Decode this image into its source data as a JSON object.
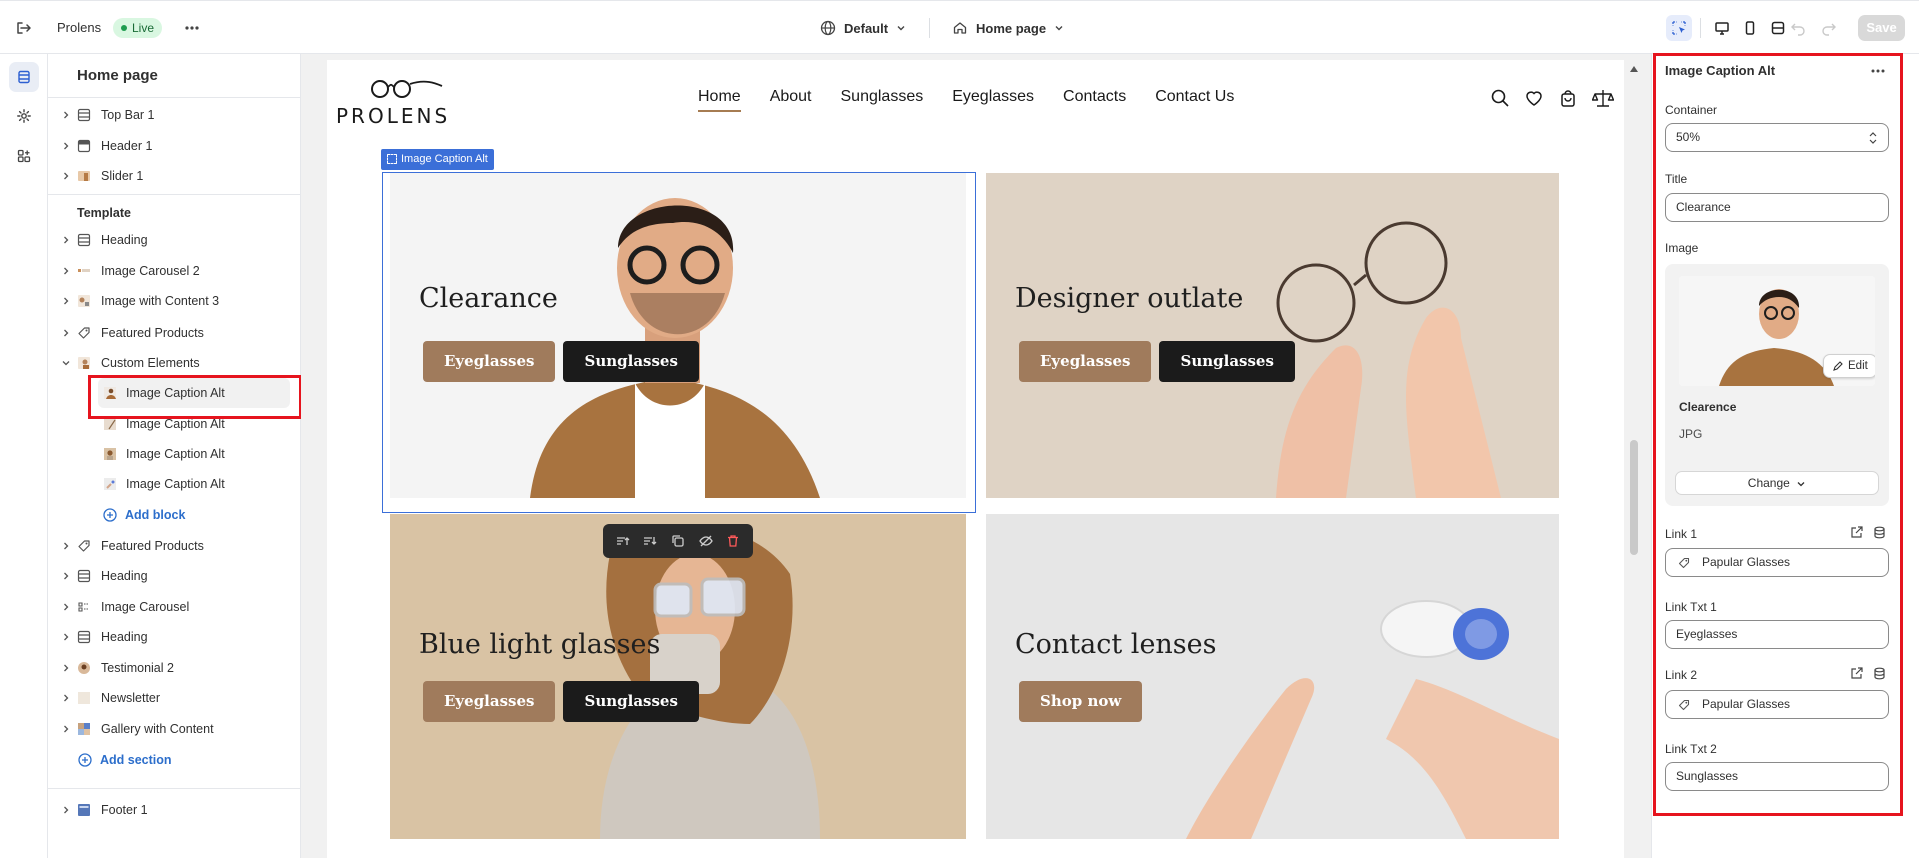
{
  "topbar": {
    "store_name": "Prolens",
    "status": "Live",
    "theme": "Default",
    "page": "Home page",
    "save_label": "Save"
  },
  "tree": {
    "title": "Home page",
    "header_items": [
      {
        "label": "Top Bar 1"
      },
      {
        "label": "Header 1"
      },
      {
        "label": "Slider 1"
      }
    ],
    "template_label": "Template",
    "template_items": [
      {
        "label": "Heading"
      },
      {
        "label": "Image Carousel 2"
      },
      {
        "label": "Image with Content 3"
      },
      {
        "label": "Featured Products"
      },
      {
        "label": "Custom Elements"
      }
    ],
    "custom_children": [
      {
        "label": "Image Caption Alt"
      },
      {
        "label": "Image Caption Alt"
      },
      {
        "label": "Image Caption Alt"
      },
      {
        "label": "Image Caption Alt"
      }
    ],
    "add_block": "Add block",
    "more_items": [
      {
        "label": "Featured Products"
      },
      {
        "label": "Heading"
      },
      {
        "label": "Image Carousel"
      },
      {
        "label": "Heading"
      },
      {
        "label": "Testimonial 2"
      },
      {
        "label": "Newsletter"
      },
      {
        "label": "Gallery with Content"
      }
    ],
    "add_section": "Add section",
    "footer_items": [
      {
        "label": "Footer 1"
      }
    ]
  },
  "site": {
    "logo": "PROLENS",
    "nav": [
      "Home",
      "About",
      "Sunglasses",
      "Eyeglasses",
      "Contacts",
      "Contact Us"
    ],
    "block_tag": "Image Caption Alt",
    "cards": [
      {
        "title": "Clearance",
        "buttons": [
          "Eyeglasses",
          "Sunglasses"
        ]
      },
      {
        "title": "Designer outlate",
        "buttons": [
          "Eyeglasses",
          "Sunglasses"
        ]
      },
      {
        "title": "Blue light glasses",
        "buttons": [
          "Eyeglasses",
          "Sunglasses"
        ]
      },
      {
        "title": "Contact lenses",
        "buttons": [
          "Shop now"
        ]
      }
    ]
  },
  "inspector": {
    "title": "Image Caption Alt",
    "container_label": "Container",
    "container_value": "50%",
    "title_label": "Title",
    "title_value": "Clearance",
    "image_label": "Image",
    "image_edit": "Edit",
    "image_name": "Clearence",
    "image_type": "JPG",
    "image_change": "Change",
    "link1_label": "Link 1",
    "link1_value": "Papular Glasses",
    "linktxt1_label": "Link Txt 1",
    "linktxt1_value": "Eyeglasses",
    "link2_label": "Link 2",
    "link2_value": "Papular Glasses",
    "linktxt2_label": "Link Txt 2",
    "linktxt2_value": "Sunglasses"
  },
  "colors": {
    "accent": "#3b6fd8",
    "highlight": "#e6141e",
    "button_tan": "#a07b5c",
    "button_dark": "#1b1b1b",
    "live_bg": "#d9f7e1"
  },
  "icons": {
    "rail": [
      "layers-icon",
      "gear-icon",
      "apps-icon"
    ],
    "devices": [
      "select-icon",
      "desktop-icon",
      "mobile-icon",
      "fullwidth-icon"
    ],
    "site": [
      "search-icon",
      "heart-icon",
      "bag-icon",
      "compare-icon"
    ],
    "float_tools": [
      "move-up-icon",
      "move-down-icon",
      "duplicate-icon",
      "hide-icon",
      "delete-icon"
    ]
  }
}
